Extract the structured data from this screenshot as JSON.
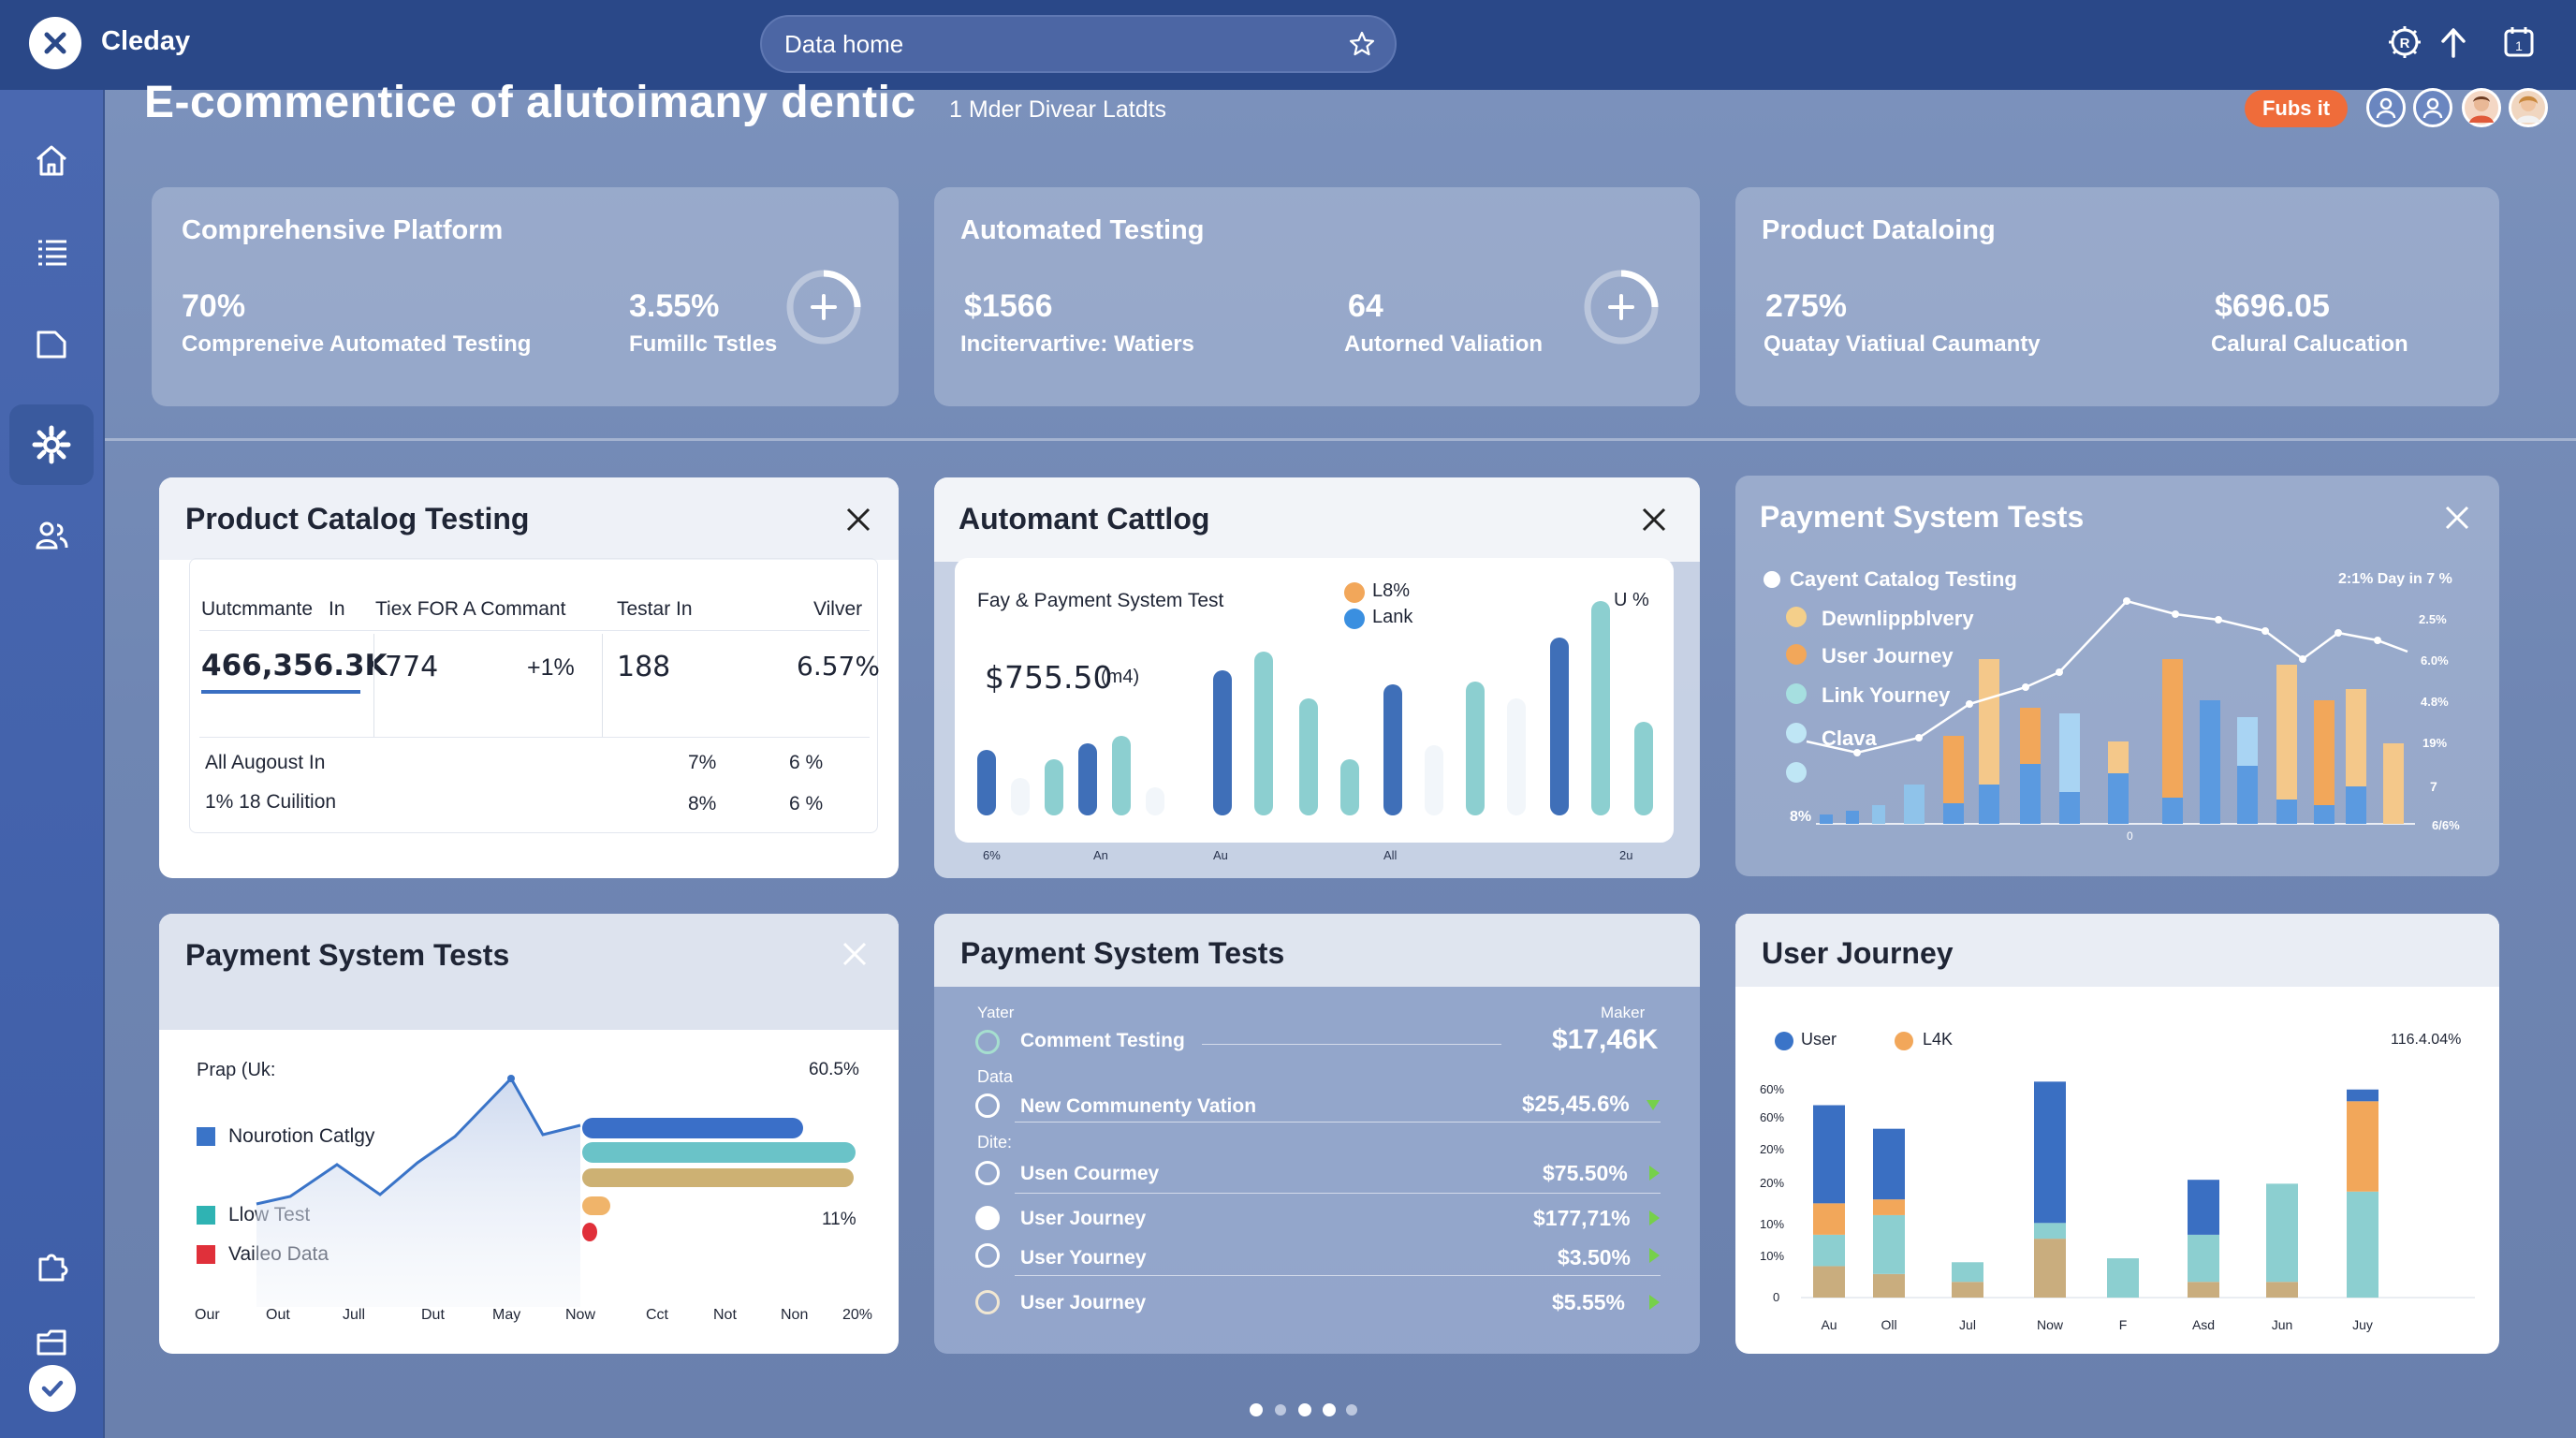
{
  "app": {
    "name": "Cleday"
  },
  "search": {
    "placeholder": "Data home"
  },
  "page": {
    "title": "E-commentice of alutoimany dentic",
    "subtitle": "1 Mder Divear Latdts",
    "badge": "Fubs it"
  },
  "stat_cards": [
    {
      "title": "Comprehensive Platform",
      "v1": "70%",
      "l1": "Compreneive Automated Testing",
      "v2": "3.55%",
      "l2": "Fumillc Tstles"
    },
    {
      "title": "Automated Testing",
      "v1": "$1566",
      "l1": "Incitervartive: Watiers",
      "v2": "64",
      "l2": "Autorned Valiation"
    },
    {
      "title": "Product Dataloing",
      "v1": "275%",
      "l1": "Quatay Viatiual Caumanty",
      "v2": "$696.05",
      "l2": "Calural Calucation"
    }
  ],
  "panel_catalog": {
    "title": "Product Catalog Testing",
    "headers": [
      "Uutcmmante",
      "In",
      "Tiex FOR A Commant",
      "Testar In",
      "Vilver"
    ],
    "values": [
      "466,356.3K",
      "774",
      "+1%",
      "188",
      "6.57%"
    ],
    "rows": [
      {
        "label": "All Augoust In",
        "a": "7%",
        "b": "6 %"
      },
      {
        "label": "1% 18 Cuilition",
        "a": "8%",
        "b": "6 %"
      }
    ]
  },
  "panel_automant": {
    "title": "Automant Cattlog",
    "subtitle": "Fay & Payment System Test",
    "amount": "$755.50",
    "amount_unit": "(m4)",
    "legend": [
      "L8%",
      "Lank"
    ],
    "right_label": "U %",
    "x_labels": [
      "6%",
      "An",
      "Au",
      "All",
      "2u"
    ]
  },
  "panel_payment_top": {
    "title": "Payment System Tests",
    "legend": [
      "Cayent Catalog Testing",
      "Dewnlippblvery",
      "User Journey",
      "Link Yourney",
      "Clava"
    ],
    "header_right": "2:1% Day in 7 %",
    "y_labels": [
      "2.5%",
      "6.0%",
      "4.8%",
      "19%",
      "7",
      "6/6%"
    ],
    "y_left": "8%",
    "x_label_mid": "0"
  },
  "panel_payment_bl": {
    "title": "Payment System Tests",
    "y_title": "Prap (Uk:",
    "top_right": "60.5%",
    "mid_right": "11%",
    "legend": [
      "Nourotion Catlgy",
      "Llow Test",
      "Vaileo Data"
    ],
    "x_labels": [
      "Our",
      "Out",
      "Jull",
      "Dut",
      "May",
      "Now",
      "Cct",
      "Not",
      "Non",
      "20%"
    ]
  },
  "panel_payment_mid": {
    "title": "Payment System Tests",
    "col_left": "Yater",
    "col_right": "Maker",
    "rows": [
      {
        "label": "Comment Testing",
        "value": "$17,46K",
        "section": ""
      },
      {
        "label": "New Communenty Vation",
        "value": "$25,45.6%",
        "section": "Data"
      },
      {
        "label": "Usen Courmey",
        "value": "$75.50%",
        "section": "Dite:"
      },
      {
        "label": "User Journey",
        "value": "$177,71%",
        "section": ""
      },
      {
        "label": "User Yourney",
        "value": "$3.50%",
        "section": ""
      },
      {
        "label": "User Journey",
        "value": "$5.55%",
        "section": ""
      }
    ]
  },
  "panel_journey": {
    "title": "User Journey",
    "legend": [
      "User",
      "L4K"
    ],
    "top_right": "116.4.04%",
    "y_labels": [
      "60%",
      "60%",
      "20%",
      "20%",
      "10%",
      "10%",
      "0"
    ]
  },
  "chart_data": [
    {
      "type": "bar",
      "title": "User Journey",
      "categories": [
        "Au",
        "Oll",
        "Jul",
        "Now",
        "F",
        "Asd",
        "Jun",
        "Juy"
      ],
      "series": [
        {
          "name": "User",
          "values": [
            0.25,
            0.18,
            0,
            0.36,
            0,
            0.14,
            0,
            0.03
          ]
        },
        {
          "name": "L4K",
          "values": [
            0.08,
            0.04,
            0,
            0,
            0,
            0,
            0,
            0.23
          ]
        }
      ],
      "stack_parts": {
        "teal": [
          0.08,
          0.15,
          0.05,
          0.04,
          0.1,
          0.12,
          0.25,
          0.27
        ],
        "tan": [
          0.08,
          0.06,
          0.04,
          0.15,
          0,
          0.04,
          0.04,
          0
        ]
      },
      "ylim": [
        0,
        0.62
      ],
      "legend_position": "top-left"
    }
  ],
  "colors": {
    "topbar": "#2a4888",
    "sidebar": "#4a68b0",
    "blue": "#3a6fc2",
    "teal": "#8ccfd0",
    "orange": "#f2a75a",
    "tan": "#c9ad7e",
    "badge": "#ef6c3a",
    "green": "#76d04a"
  },
  "pager": {
    "count": 5,
    "active": 0
  }
}
